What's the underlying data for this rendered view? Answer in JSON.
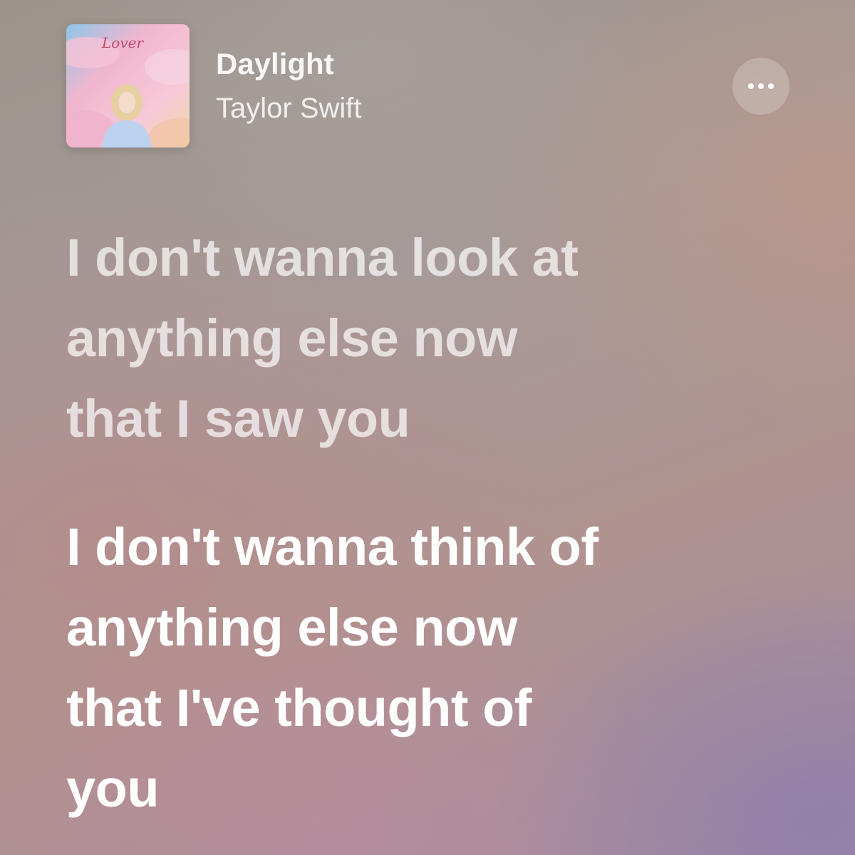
{
  "now_playing": {
    "artwork_title": "Lover",
    "song_title": "Daylight",
    "artist": "Taylor Swift",
    "more_icon": "ellipsis-icon"
  },
  "lyrics": [
    {
      "state": "past",
      "lines": [
        "I don't wanna look at",
        "anything else now",
        "that I saw you"
      ]
    },
    {
      "state": "current",
      "lines": [
        "I don't wanna think of",
        "anything else now",
        "that I've thought of",
        "you"
      ]
    }
  ],
  "colors": {
    "text": "#ffffff",
    "background_gray": "#a69a98",
    "background_pink": "#b98787",
    "background_purple": "#8c7daf"
  }
}
